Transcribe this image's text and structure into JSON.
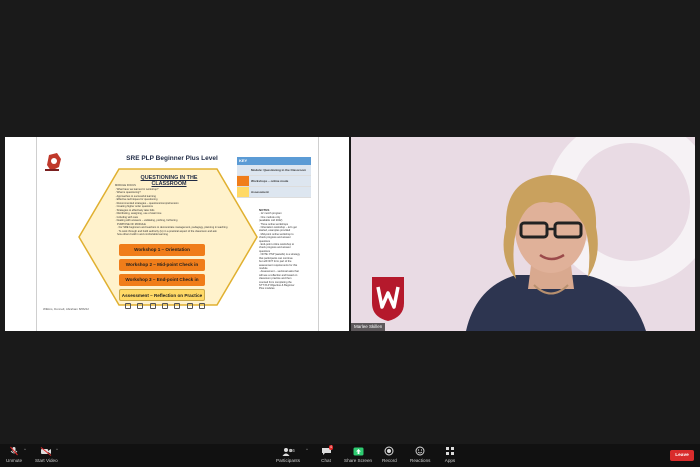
{
  "slide": {
    "title": "SRE PLP Beginner Plus Level",
    "section_title": "QUESTIONING IN THE CLASSROOM",
    "overview_lines": [
      "MODULE FOCUS",
      "· What have we learned in workshop?",
      "· What is questioning?",
      "· Approaches to successful learning",
      "· Effective techniques for questioning",
      "· Recommended strategies – questions/comprehension",
      "    · Creating higher order questions",
      "    · Strategies to effectively take bids",
      "    · Distributing, assigning, use of wait time",
      "    · Including with care",
      "    · Dealing with answers – validating, probing, furthering"
    ],
    "purpose_lines": [
      "PURPOSE OF MODULE",
      "· For SRE beginners and teachers to demonstrate management, pedagogy, planning in teaching",
      "· To work through and build authority (to) in a practical aspect of the classroom and ask",
      "  how others build in and comfortable learning"
    ],
    "workshops": [
      "Workshop 1 – Orientation",
      "Workshop 2 – Mid-point Check in",
      "Workshop 3 – End-point Check in"
    ],
    "assessment": "Assessment – Reflection on Practice",
    "footer_note": "Wilkins, Donnell, Abraham 8/06/22",
    "key": {
      "heading": "KEY",
      "rows": [
        {
          "label": "Module: Questioning in the Classroom",
          "color": "#dde6f0"
        },
        {
          "label": "Workshops – online mode",
          "color": "#f07d1a"
        },
        {
          "label": "Assessment",
          "color": "#ffd966"
        }
      ]
    },
    "notes": {
      "heading": "NOTES",
      "lines": [
        "· 12 month program",
        "· One module only",
        "  (available mid 2022)",
        "· Three online workshops",
        "· Orientation workshop – let's get",
        "  started, examples provided",
        "· Mid-point online workshop to",
        "  check progress and answer",
        "  questions",
        "· End-point online workshop to",
        "  check progress and answer",
        "  questions",
        "· NOTE: PSP (awards) is a strategy",
        "  that participants can continue",
        "  but will NOT form part of the",
        "  assessment requirements for this",
        "  module",
        "· Assessment – sectional asks that",
        "  will see a reflection and based on",
        "  classroom practice and then",
        "  counted from completing the",
        "  STT PLP Objective & Beginner",
        "  Plus modules"
      ]
    }
  },
  "video": {
    "participant_name": "Marlee Skillen",
    "ring_color": "#f6f2f5",
    "background_color": "#e9dbe4",
    "shield_color": "#b5192c"
  },
  "toolbar": {
    "unmute": "Unmute",
    "start_video": "Start Video",
    "participants": "Participants",
    "participants_count": "26",
    "chat": "Chat",
    "chat_badge": "4",
    "share_screen": "Share Screen",
    "record": "Record",
    "reactions": "Reactions",
    "apps": "Apps",
    "leave": "Leave",
    "share_color": "#2ecc71",
    "leave_color": "#d92c2c"
  }
}
